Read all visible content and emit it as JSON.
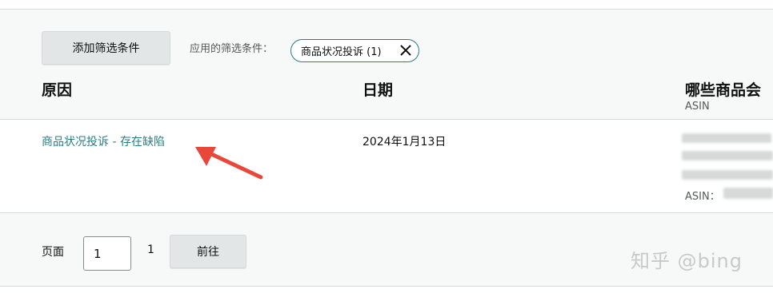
{
  "filters": {
    "add_button_label": "添加筛选条件",
    "applied_label": "应用的筛选条件：",
    "chip_label": "商品状况投诉 (1)"
  },
  "table": {
    "headers": {
      "reason": "原因",
      "date": "日期",
      "products": "哪些商品会",
      "products_sub": "ASIN"
    },
    "rows": [
      {
        "reason": "商品状况投诉 - 存在缺陷",
        "date": "2024年1月13日",
        "asin_label": "ASIN："
      }
    ]
  },
  "pagination": {
    "page_label": "页面",
    "page_value": "1",
    "total_pages": "1",
    "go_button_label": "前往"
  },
  "watermark": "知乎 @bing",
  "colors": {
    "link": "#2a7d83",
    "header_bg": "#f7f8f8",
    "button_bg": "#e3e6e6",
    "annotation_arrow": "#e8483a"
  },
  "icons": {
    "chip_close": "close-icon",
    "annotation": "red-arrow-annotation"
  }
}
